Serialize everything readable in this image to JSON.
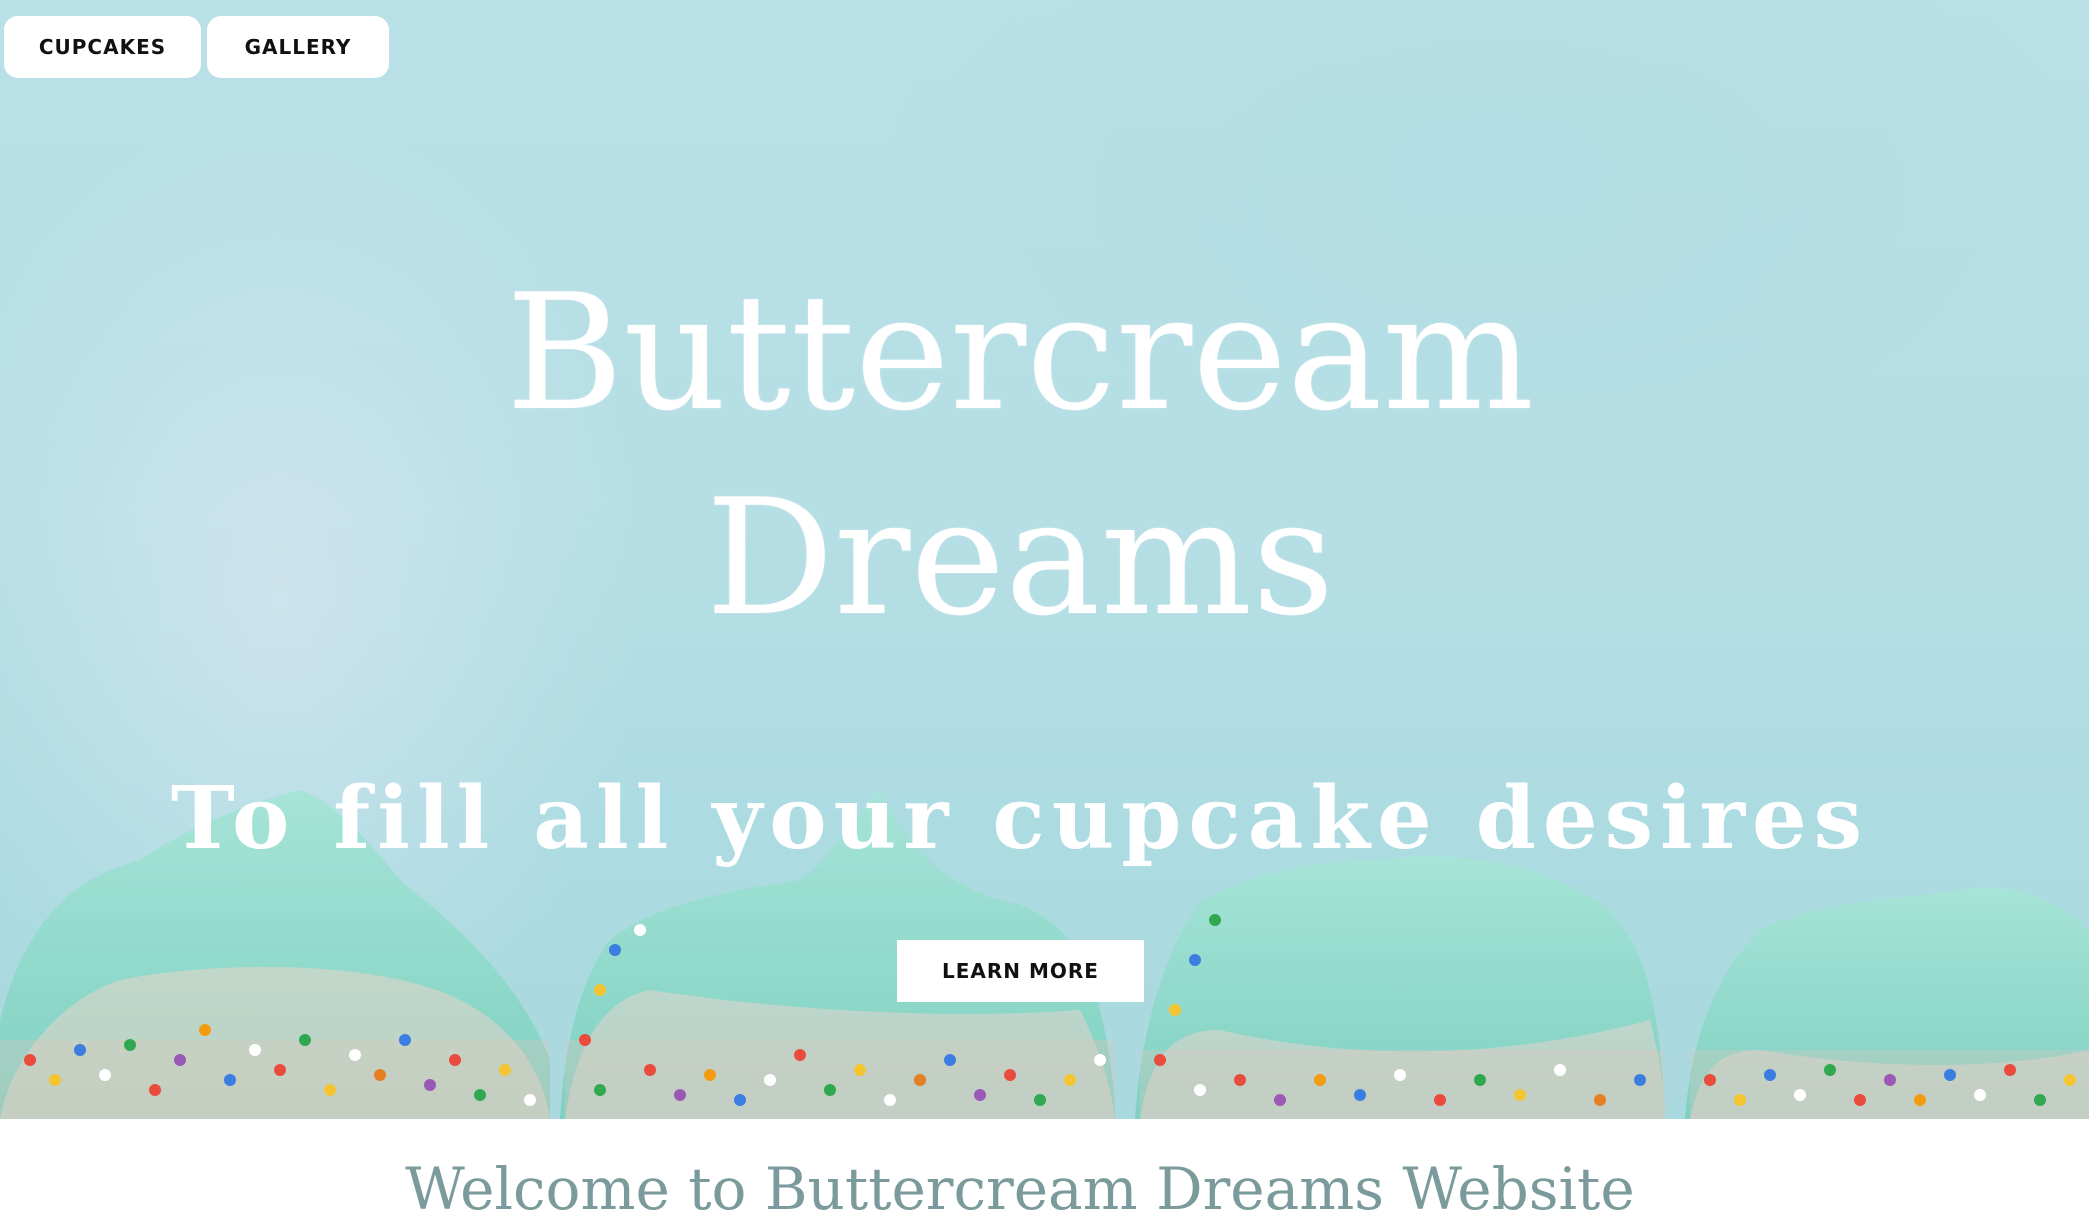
{
  "nav": {
    "cupcakes_label": "CUPCAKES",
    "gallery_label": "GALLERY"
  },
  "hero": {
    "title_line1": "Buttercream",
    "title_line2": "Dreams",
    "subtitle": "To fill all your cupcake desires",
    "cta_label": "LEARN MORE"
  },
  "welcome": {
    "heading": "Welcome to Buttercream Dreams Website"
  },
  "colors": {
    "sky": "#b8e0e6",
    "frosting": "#8ad6c8",
    "heading_text": "#7a9a9c",
    "button_bg": "#ffffff"
  }
}
